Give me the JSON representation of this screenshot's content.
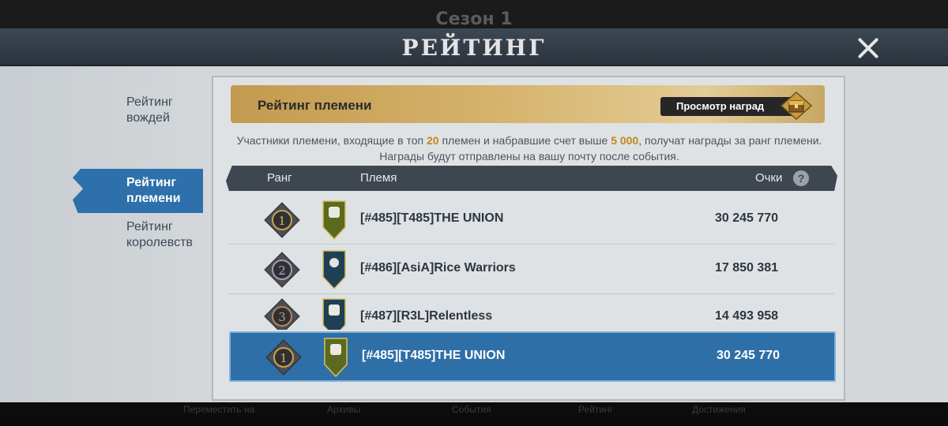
{
  "background": {
    "season_title": "Сезон 1",
    "bottom_nav": [
      "Переместить на",
      "Архивы",
      "События",
      "Рейтинг",
      "Достижения"
    ]
  },
  "header": {
    "title": "РЕЙТИНГ"
  },
  "sidebar": {
    "items": [
      {
        "label": "Рейтинг вождей",
        "active": false
      },
      {
        "label": "Рейтинг племени",
        "active": true
      },
      {
        "label": "Рейтинг королевств",
        "active": false
      }
    ]
  },
  "banner": {
    "title": "Рейтинг племени",
    "rewards_button": "Просмотр наград"
  },
  "info": {
    "part1": "Участники племени, входящие в топ ",
    "top_count": "20",
    "part2": " племен и набравшие счет выше ",
    "min_score": "5 000",
    "part3": ", получат награды за ранг племени. Награды будут отправлены на вашу почту после события."
  },
  "table": {
    "headers": {
      "rank": "Ранг",
      "tribe": "Племя",
      "points": "Очки"
    },
    "rows": [
      {
        "rank": "1",
        "name": "[#485][T485]THE UNION",
        "points": "30 245 770"
      },
      {
        "rank": "2",
        "name": "[#486][AsiA]Rice Warriors",
        "points": "17 850 381"
      },
      {
        "rank": "3",
        "name": "[#487][R3L]Relentless",
        "points": "14 493 958"
      }
    ],
    "my_row": {
      "rank": "1",
      "name": "[#485][T485]THE UNION",
      "points": "30 245 770"
    }
  },
  "colors": {
    "accent": "#2f6fa7",
    "gold": "#c2881a",
    "header": "#3e4750"
  }
}
